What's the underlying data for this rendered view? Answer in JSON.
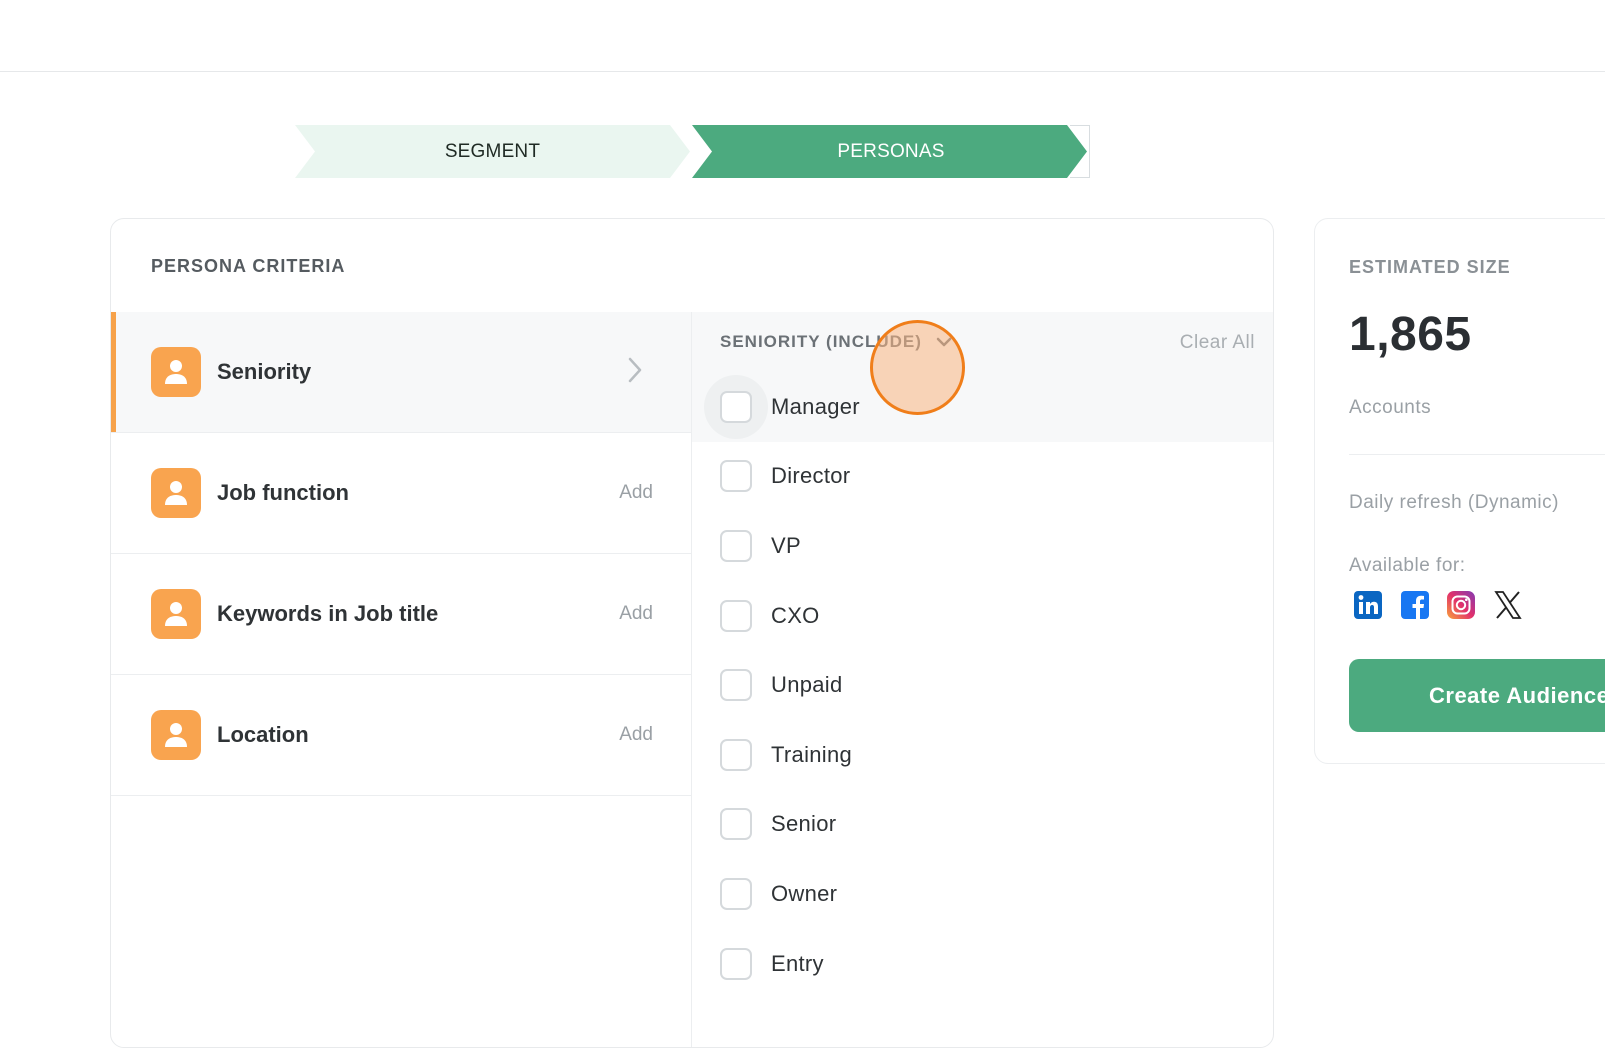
{
  "stepper": {
    "steps": [
      {
        "label": "SEGMENT",
        "state": "done"
      },
      {
        "label": "PERSONAS",
        "state": "active"
      }
    ]
  },
  "criteria": {
    "title": "PERSONA CRITERIA",
    "items": [
      {
        "label": "Seniority",
        "action": "",
        "active": true
      },
      {
        "label": "Job function",
        "action": "Add"
      },
      {
        "label": "Keywords in Job title",
        "action": "Add"
      },
      {
        "label": "Location",
        "action": "Add"
      }
    ],
    "icon": "person-icon"
  },
  "seniority": {
    "header": "SENIORITY (INCLUDE)",
    "clear_all": "Clear All",
    "options": [
      "Manager",
      "Director",
      "VP",
      "CXO",
      "Unpaid",
      "Training",
      "Senior",
      "Owner",
      "Entry"
    ],
    "hovered": "Manager"
  },
  "estimate": {
    "title": "ESTIMATED SIZE",
    "count": "1,865",
    "unit": "Accounts",
    "refresh": "Daily refresh (Dynamic)",
    "available_for": "Available for:",
    "platforms": [
      "linkedin-icon",
      "facebook-icon",
      "instagram-icon",
      "x-icon"
    ],
    "create_button": "Create Audience"
  },
  "colors": {
    "accent_green": "#4caa7f",
    "accent_orange": "#f9a44f",
    "cursor_orange": "#f07e1a"
  }
}
